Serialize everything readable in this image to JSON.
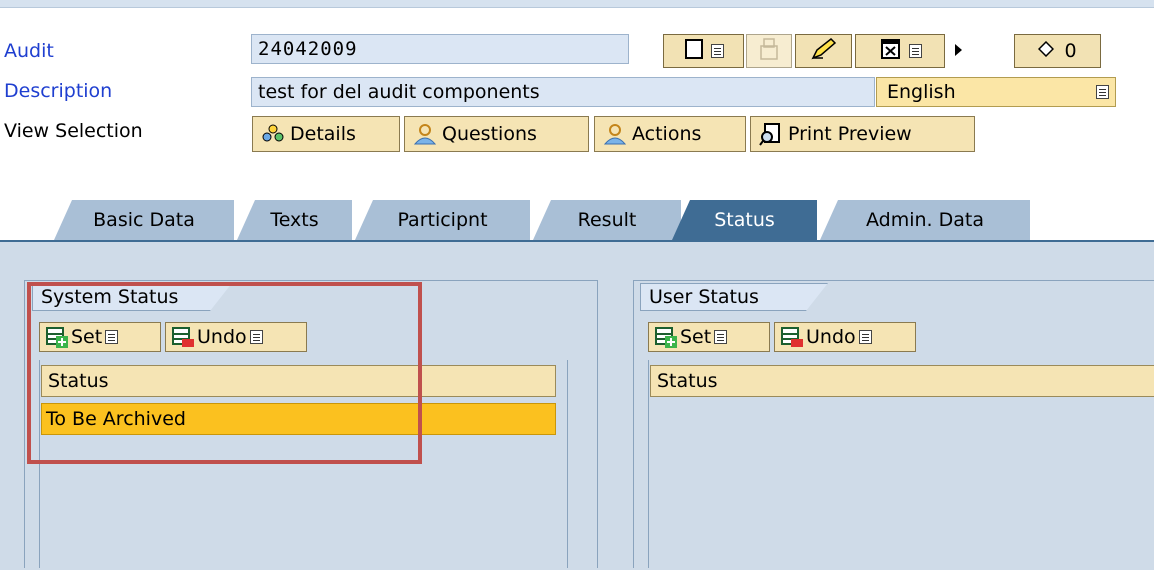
{
  "header": {
    "audit_label": "Audit",
    "audit_value": "24042009",
    "description_label": "Description",
    "description_value": "test for del audit components",
    "language_value": "English",
    "view_selection_label": "View Selection",
    "counter_value": "0"
  },
  "view_buttons": [
    {
      "label": "Details",
      "icon": "details-icon"
    },
    {
      "label": "Questions",
      "icon": "people-icon"
    },
    {
      "label": "Actions",
      "icon": "people-icon"
    },
    {
      "label": "Print Preview",
      "icon": "print-preview-icon"
    }
  ],
  "tabs": [
    {
      "label": "Basic Data"
    },
    {
      "label": "Texts"
    },
    {
      "label": "Participnt"
    },
    {
      "label": "Result"
    },
    {
      "label": "Status",
      "active": true
    },
    {
      "label": "Admin. Data"
    }
  ],
  "system_status": {
    "title": "System Status",
    "set_label": "Set",
    "undo_label": "Undo",
    "column_header": "Status",
    "rows": [
      "To Be Archived"
    ]
  },
  "user_status": {
    "title": "User Status",
    "set_label": "Set",
    "undo_label": "Undo",
    "column_header": "Status"
  },
  "colors": {
    "tab_active": "#3f6c94",
    "tab_inactive": "#a9bfd6",
    "selected_row": "#fbc11f",
    "highlight_box": "#c0504d",
    "label_blue": "#1f3fd0"
  }
}
